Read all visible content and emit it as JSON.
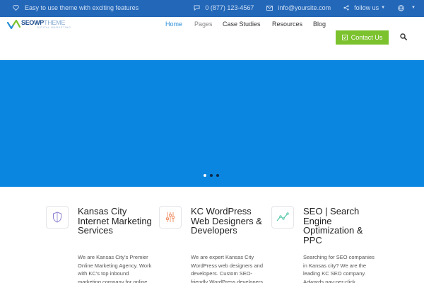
{
  "topbar": {
    "tagline": "Easy to use theme with exciting features",
    "phone": "0 (877) 123-4567",
    "email": "info@yoursite.com",
    "follow": "follow us"
  },
  "logo": {
    "bold": "SEOWP",
    "thin": "THEME",
    "subtitle": "DIGITAL MARKETING"
  },
  "nav": {
    "items": [
      "Home",
      "Pages",
      "Case Studies",
      "Resources",
      "Blog"
    ],
    "active": "Home",
    "contact": "Contact Us"
  },
  "hero": {
    "color": "#0a85e0",
    "slides": 3,
    "active_slide": 1
  },
  "features": [
    {
      "icon": "shield-icon",
      "icon_color": "#8a7fd1",
      "title": "Kansas City Internet Marketing Services",
      "text": "We are Kansas City's Premier Online Marketing Agency. Work with KC's top inbound marketing company for online"
    },
    {
      "icon": "sliders-icon",
      "icon_color": "#f08a5d",
      "title": "KC WordPress Web Designers & Developers",
      "text": "We are expert Kansas City WordPress web designers and developers. Custom SEO-friendly WordPress developers in Kansas City."
    },
    {
      "icon": "line-chart-icon",
      "icon_color": "#3bbf9b",
      "title": "SEO | Search Engine Optimization & PPC",
      "text": "Searching for SEO companies in Kansas city?  We are the leading KC SEO company. Adwords pay-per-click"
    }
  ]
}
